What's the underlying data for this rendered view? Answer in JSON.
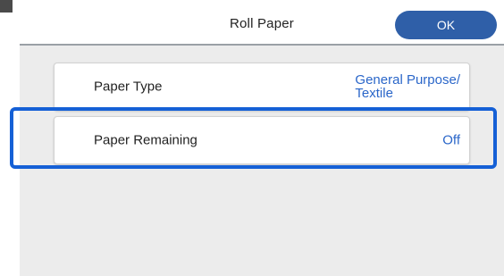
{
  "header": {
    "title": "Roll Paper",
    "ok_label": "OK"
  },
  "settings": [
    {
      "label": "Paper Type",
      "value_line1": "General Purpose/",
      "value_line2": "Textile"
    },
    {
      "label": "Paper Remaining",
      "value": "Off"
    }
  ],
  "colors": {
    "accent": "#2f5fa8",
    "value_text": "#2a66c9",
    "highlight": "#1560d6",
    "panel_bg": "#ececec"
  }
}
